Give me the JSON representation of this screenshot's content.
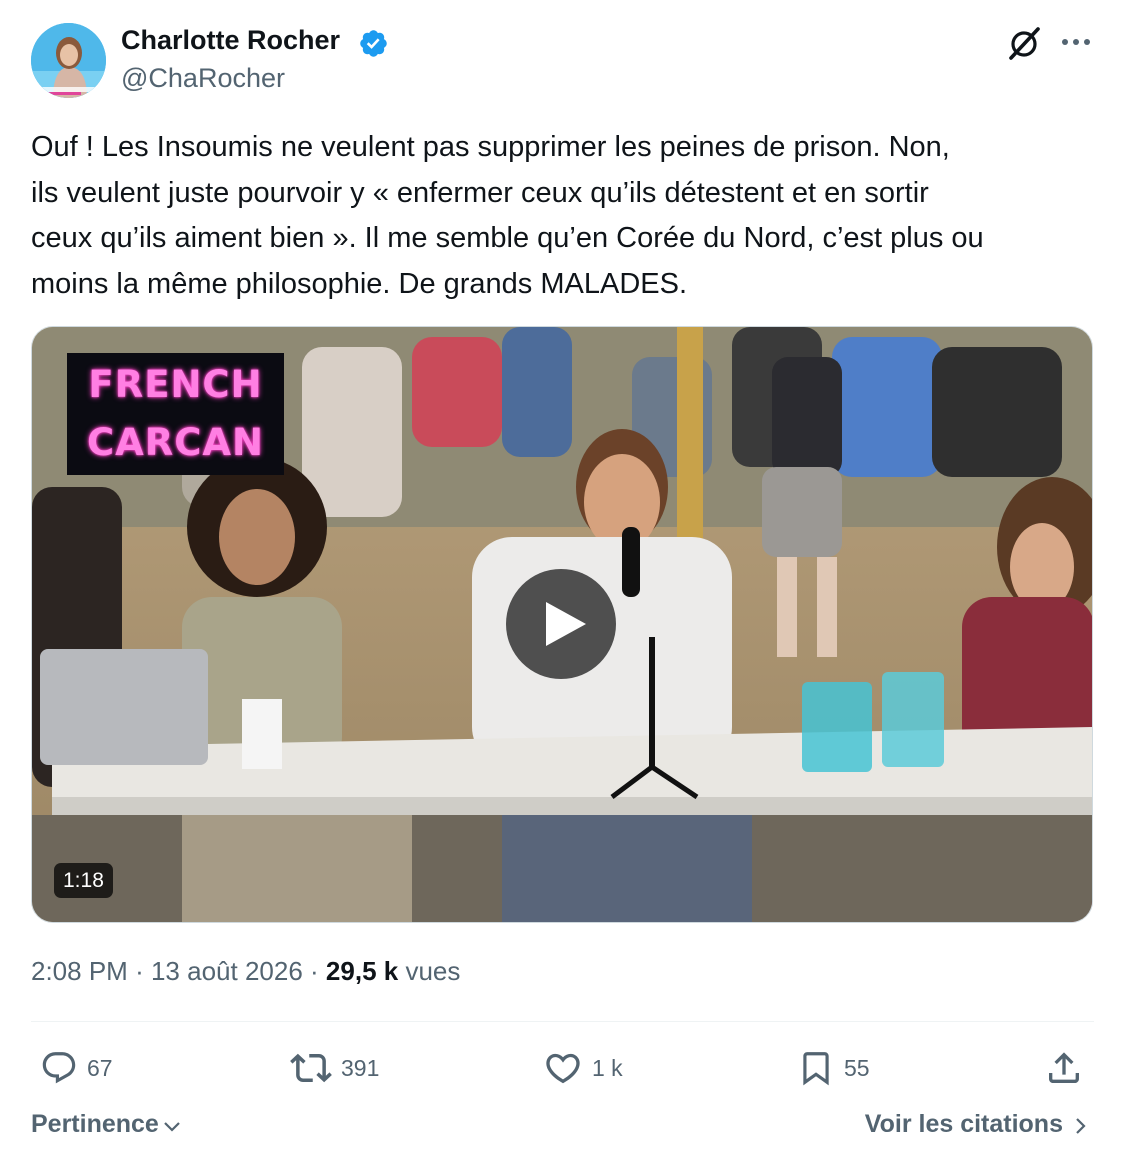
{
  "author": {
    "name": "Charlotte Rocher",
    "handle": "@ChaRocher",
    "verified": true,
    "verified_color": "#1d9bf0",
    "avatar_icon": "avatar"
  },
  "header_icons": [
    "grok-icon",
    "more-icon"
  ],
  "tweet": {
    "text": "Ouf ! Les Insoumis ne veulent pas supprimer les peines de prison. Non,\nils veulent juste pourvoir y « enfermer ceux qu’ils détestent et en sortir\nceux qu’ils aiment bien ». Il me semble qu’en Corée du Nord, c’est plus ou\nmoins la même philosophie. De grands MALADES."
  },
  "media": {
    "type": "video",
    "badge_line1": "FRENCH",
    "badge_line2": "CARCAN",
    "badge_color": "#ff7fe3",
    "duration": "1:18",
    "play_icon": "play-icon"
  },
  "meta": {
    "time": "2:08 PM",
    "separator": "·",
    "date": "13 août 2026",
    "views_count": "29,5 k",
    "views_label": "vues"
  },
  "actions": {
    "reply": {
      "icon": "reply-icon",
      "count": "67"
    },
    "retweet": {
      "icon": "retweet-icon",
      "count": "391"
    },
    "like": {
      "icon": "heart-icon",
      "count": "1 k"
    },
    "bookmark": {
      "icon": "bookmark-icon",
      "count": "55"
    },
    "share": {
      "icon": "share-icon"
    }
  },
  "footer": {
    "sort_label": "Pertinence",
    "quotes_label": "Voir les citations"
  },
  "colors": {
    "text_primary": "#0f1419",
    "text_secondary": "#536471",
    "divider": "#eff3f4"
  }
}
